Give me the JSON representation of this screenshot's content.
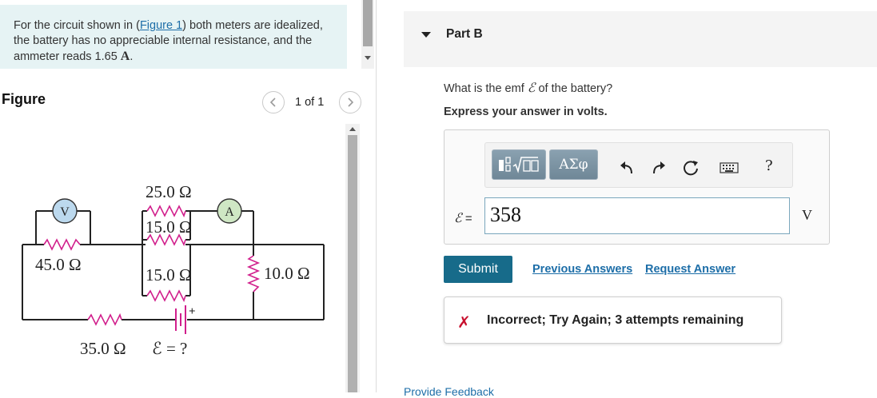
{
  "problem": {
    "text_before": "For the circuit shown in (",
    "figure_link": "Figure 1",
    "text_after": ") both meters are idealized, the battery has no appreciable internal resistance, and the ammeter reads 1.65 ",
    "unit": "A",
    "period": "."
  },
  "figure": {
    "title": "Figure",
    "page_count": "1 of 1",
    "labels": {
      "r25": "25.0 Ω",
      "r15_top": "15.0 Ω",
      "r15_mid": "15.0 Ω",
      "r45": "45.0 Ω",
      "r10": "10.0 Ω",
      "r35": "35.0 Ω",
      "emf": "ℰ = ?",
      "voltmeter": "V",
      "ammeter": "A",
      "plus": "+"
    }
  },
  "part": {
    "title": "Part B",
    "question_before": "What is the emf ",
    "emf_symbol": "ℰ",
    "question_after": " of the battery?",
    "instruction": "Express your answer in volts.",
    "toolbar": {
      "greek_label": "ΑΣφ",
      "help_label": "?"
    },
    "answer_symbol": "ℰ",
    "answer_equals": " =",
    "answer_value": "358",
    "answer_unit": "V",
    "submit_label": "Submit",
    "previous_answers_label": "Previous Answers",
    "request_answer_label": "Request Answer",
    "feedback": {
      "icon": "✗",
      "message": "Incorrect; Try Again; 3 attempts remaining"
    },
    "provide_feedback_label": "Provide Feedback"
  }
}
